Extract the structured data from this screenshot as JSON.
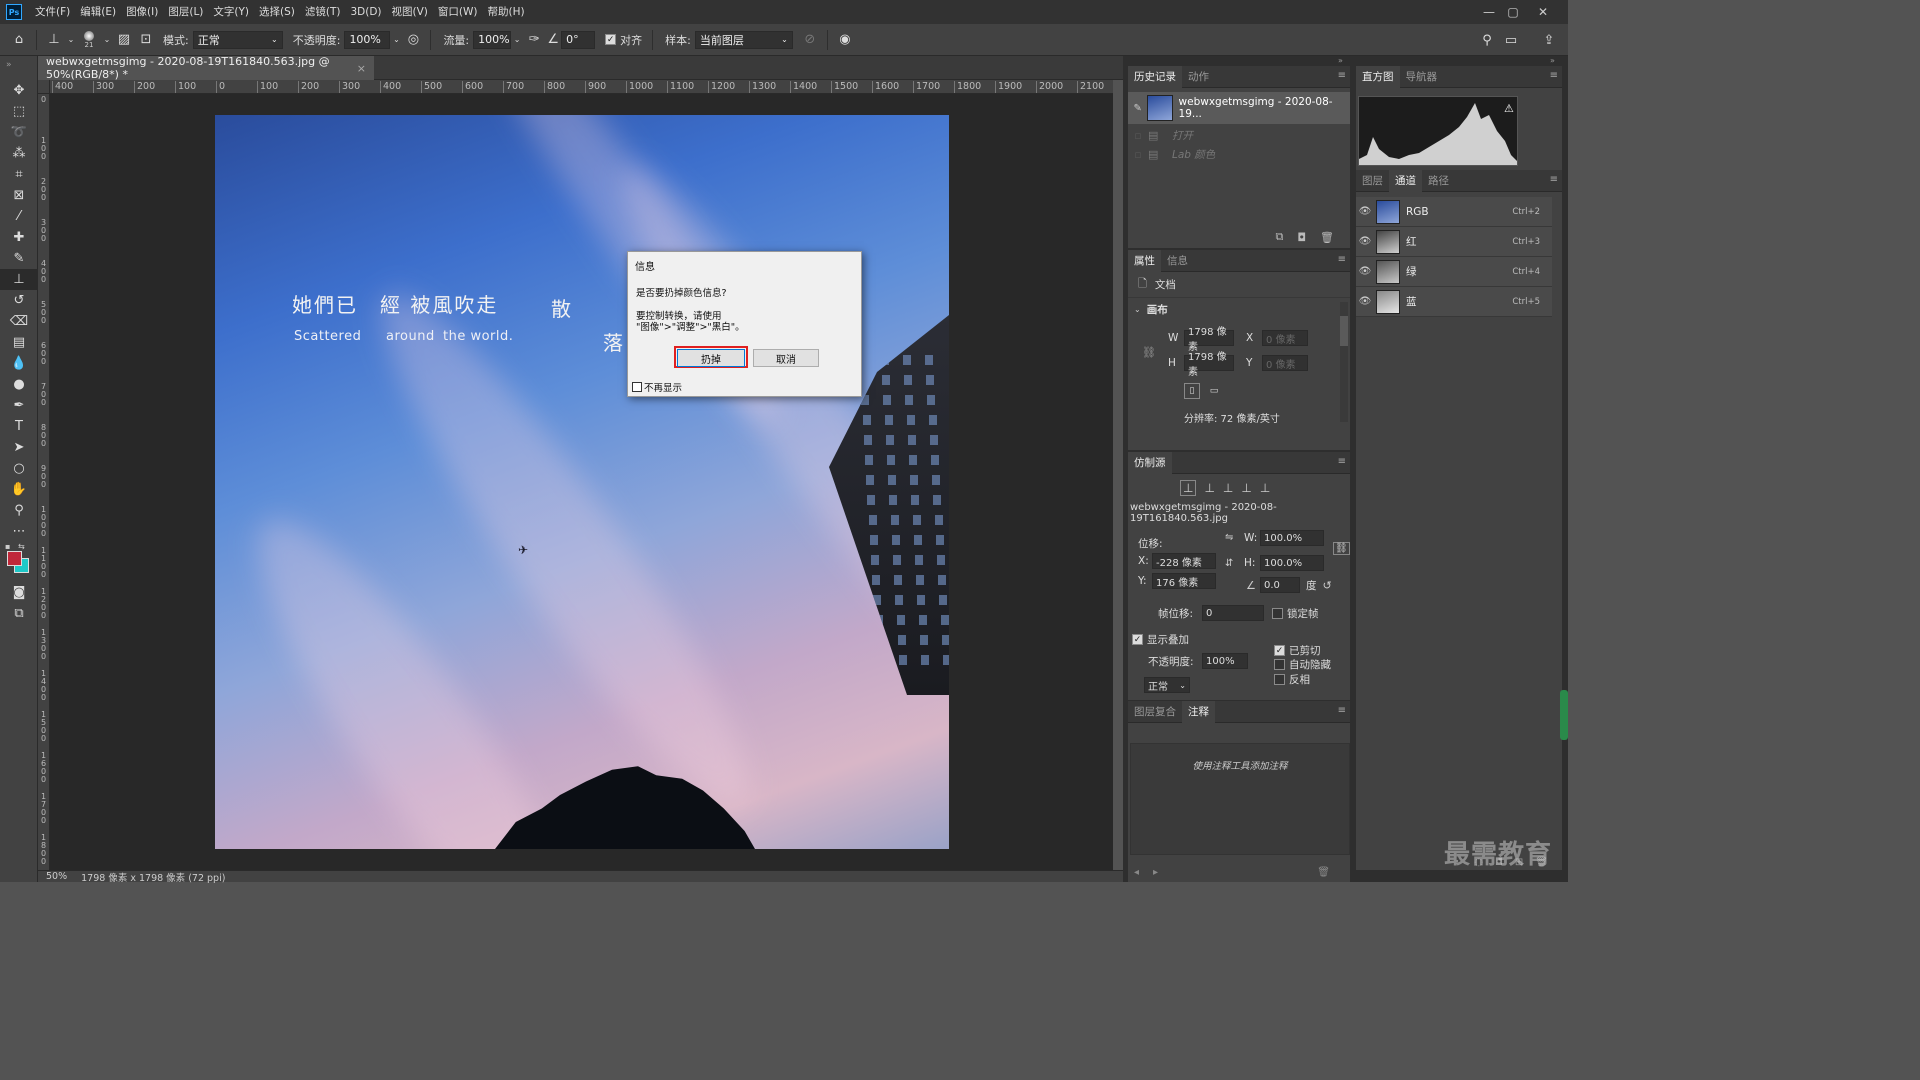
{
  "menubar": {
    "logo": "Ps",
    "items": [
      "文件(F)",
      "编辑(E)",
      "图像(I)",
      "图层(L)",
      "文字(Y)",
      "选择(S)",
      "滤镜(T)",
      "3D(D)",
      "视图(V)",
      "窗口(W)",
      "帮助(H)"
    ],
    "window_controls": [
      "—",
      "▢",
      "✕"
    ]
  },
  "options": {
    "brush_size": "21",
    "mode_label": "模式:",
    "mode_value": "正常",
    "opacity_label": "不透明度:",
    "opacity_value": "100%",
    "flow_label": "流量:",
    "flow_value": "100%",
    "angle_value": "0°",
    "align_label": "对齐",
    "sample_label": "样本:",
    "sample_value": "当前图层"
  },
  "document": {
    "tab_title": "webwxgetmsgimg - 2020-08-19T161840.563.jpg @ 50%(RGB/8*) *",
    "close": "×"
  },
  "ruler": {
    "h_ticks": [
      "400",
      "300",
      "200",
      "100",
      "0",
      "100",
      "200",
      "300",
      "400",
      "500",
      "600",
      "700",
      "800",
      "900",
      "1000",
      "1100",
      "1200",
      "1300",
      "1400",
      "1500",
      "1600",
      "1700",
      "1800",
      "1900",
      "2000",
      "2100"
    ]
  },
  "image_text": {
    "cn_line": "她們已　經 被風吹走",
    "cn_san": "散",
    "cn_luo": "落",
    "en_1": "Scattered",
    "en_2": "around",
    "en_3": "the world."
  },
  "dialog": {
    "title": "信息",
    "question": "是否要扔掉颜色信息?",
    "hint_1": "要控制转换，请使用",
    "hint_2": "\"图像\">\"调整\">\"黑白\"。",
    "discard_button": "扔掉",
    "cancel_button": "取消",
    "dont_show": "不再显示"
  },
  "history_panel": {
    "tabs": [
      "历史记录",
      "动作"
    ],
    "snapshot": "webwxgetmsgimg - 2020-08-19...",
    "items": [
      "打开",
      "Lab 颜色"
    ]
  },
  "histogram_panel": {
    "tabs": [
      "直方图",
      "导航器"
    ],
    "warning": "⚠"
  },
  "properties_panel": {
    "tabs": [
      "属性",
      "信息"
    ],
    "doc_label": "文档",
    "section": "画布",
    "w_label": "W",
    "w_value": "1798 像素",
    "h_label": "H",
    "h_value": "1798 像素",
    "x_label": "X",
    "x_value": "0 像素",
    "y_label": "Y",
    "y_value": "0 像素",
    "resolution": "分辨率: 72 像素/英寸"
  },
  "channels_panel": {
    "tabs": [
      "图层",
      "通道",
      "路径"
    ],
    "channels": [
      {
        "name": "RGB",
        "shortcut": "Ctrl+2"
      },
      {
        "name": "红",
        "shortcut": "Ctrl+3"
      },
      {
        "name": "绿",
        "shortcut": "Ctrl+4"
      },
      {
        "name": "蓝",
        "shortcut": "Ctrl+5"
      }
    ]
  },
  "clone_panel": {
    "tab": "仿制源",
    "source_file": "webwxgetmsgimg - 2020-08-19T161840.563.jpg",
    "offset_label": "位移:",
    "x_label": "X:",
    "x_value": "-228 像素",
    "y_label": "Y:",
    "y_value": "176 像素",
    "w_label": "W:",
    "w_value": "100.0%",
    "h_label": "H:",
    "h_value": "100.0%",
    "angle_value": "0.0",
    "deg": "度",
    "frame_offset_label": "帧位移:",
    "frame_offset_value": "0",
    "lock_frame": "锁定帧",
    "show_overlay": "显示叠加",
    "clipped": "已剪切",
    "auto_hide": "自动隐藏",
    "invert": "反相",
    "opacity_label": "不透明度:",
    "opacity_value": "100%",
    "blend_mode": "正常"
  },
  "notes_panel": {
    "tabs": [
      "图层复合",
      "注释"
    ],
    "hint": "使用注释工具添加注释"
  },
  "status": {
    "zoom": "50%",
    "doc_info": "1798 像素 x 1798 像素 (72 ppi)"
  },
  "watermark": "最需教育",
  "colors": {
    "foreground": "#c0283a",
    "background": "#1ec8c8",
    "highlight": "#e02020"
  }
}
